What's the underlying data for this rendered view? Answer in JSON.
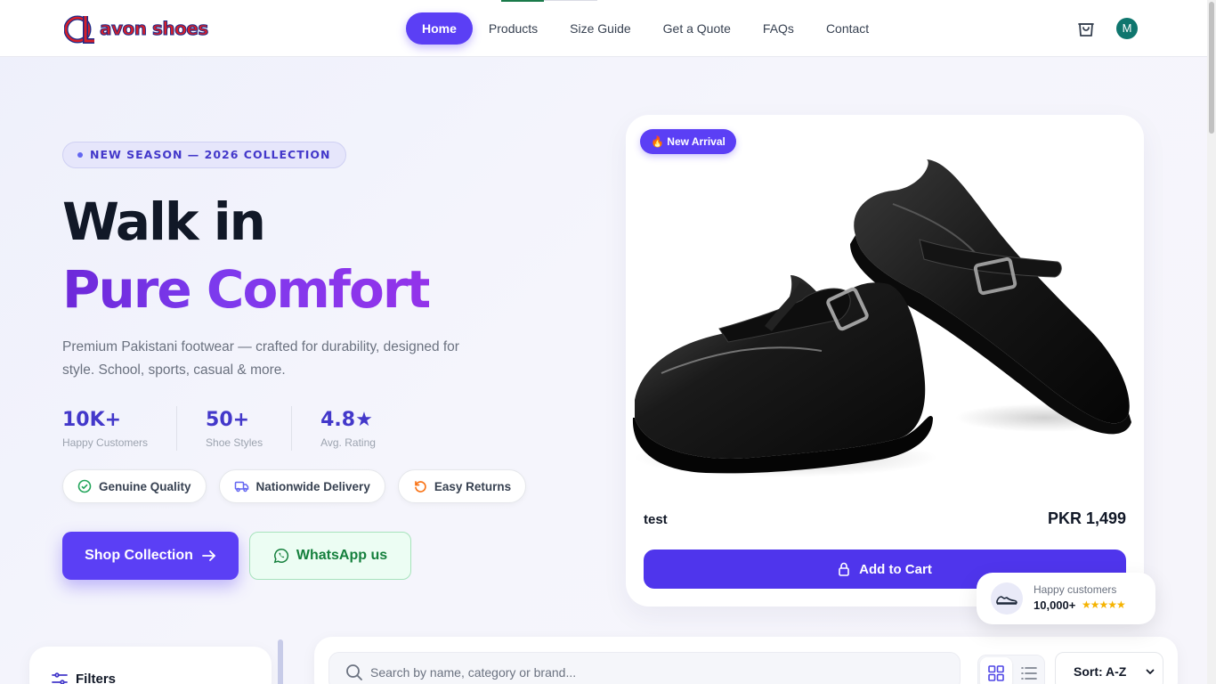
{
  "header": {
    "logo_mark": "a",
    "logo_text_1": "avon",
    "logo_text_2": "shoes",
    "nav": [
      {
        "label": "Home",
        "active": true
      },
      {
        "label": "Products"
      },
      {
        "label": "Size Guide"
      },
      {
        "label": "Get a Quote"
      },
      {
        "label": "FAQs"
      },
      {
        "label": "Contact"
      }
    ],
    "cart_icon": "shopping-bag-icon",
    "avatar_initial": "M",
    "avatar_color": "#0f766e"
  },
  "hero": {
    "badge": "NEW SEASON — 2026 COLLECTION",
    "title_line1": "Walk in",
    "title_line2": "Pure Comfort",
    "description": "Premium Pakistani footwear — crafted for durability, designed for style. School, sports, casual & more.",
    "stats": [
      {
        "value": "10K+",
        "label": "Happy Customers"
      },
      {
        "value": "50+",
        "label": "Shoe Styles"
      },
      {
        "value": "4.8★",
        "label": "Avg. Rating"
      }
    ],
    "features": [
      {
        "label": "Genuine Quality",
        "icon": "check-circle-icon"
      },
      {
        "label": "Nationwide Delivery",
        "icon": "truck-icon"
      },
      {
        "label": "Easy Returns",
        "icon": "refresh-icon"
      }
    ],
    "shop_button": "Shop Collection",
    "whatsapp_button": "WhatsApp us"
  },
  "product_card": {
    "badge": "🔥 New Arrival",
    "name": "test",
    "price": "PKR 1,499",
    "add_to_cart": "Add to Cart"
  },
  "happy_card": {
    "label": "Happy customers",
    "count": "10,000+",
    "stars": "★★★★★"
  },
  "filters": {
    "title": "Filters"
  },
  "toolbar": {
    "search_placeholder": "Search by name, category or brand...",
    "sort_value": "Sort: A-Z"
  },
  "colors": {
    "accent": "#5b3ff5",
    "title_gradient": "#7c3aed",
    "whatsapp_green": "#15803d"
  }
}
